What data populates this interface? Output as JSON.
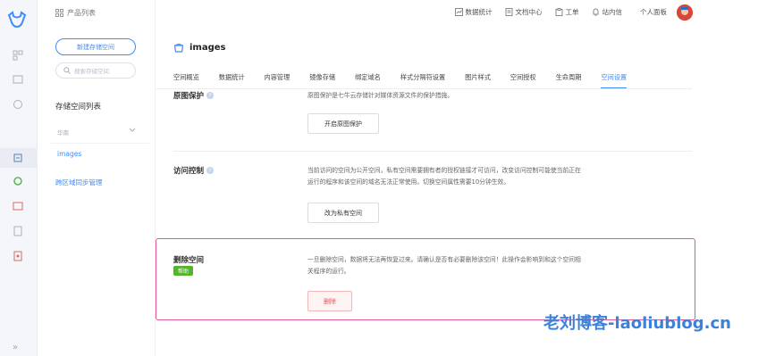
{
  "sidebar_rail": {
    "logo": "qiniu-cow-logo",
    "icons": [
      "overview-icon",
      "cdn-icon",
      "storage-icon",
      "kodo-icon",
      "media-icon",
      "monitor-icon",
      "log-icon",
      "billing-icon"
    ],
    "collapse_label": "»"
  },
  "side": {
    "product_list": "产品列表",
    "new_bucket_button": "新建存储空间",
    "search_placeholder": "搜索存储空间",
    "list_title": "存储空间列表",
    "group_label": "华南",
    "bucket_name": "images",
    "cross_region_sync": "跨区域同步管理"
  },
  "header": {
    "links": [
      {
        "label": "数据统计",
        "icon": "chart-icon"
      },
      {
        "label": "文档中心",
        "icon": "doc-icon"
      },
      {
        "label": "工单",
        "icon": "ticket-icon"
      },
      {
        "label": "站内信",
        "icon": "bell-icon"
      }
    ],
    "personal_panel": "个人面板"
  },
  "main": {
    "bucket_title": "images",
    "tabs": [
      "空间概览",
      "数据统计",
      "内容管理",
      "镜像存储",
      "绑定域名",
      "样式分隔符设置",
      "图片样式",
      "空间授权",
      "生命周期",
      "空间设置"
    ],
    "active_tab": "空间设置",
    "origin_protect": {
      "title": "原图保护",
      "desc": "原图保护是七牛云存储针对媒体资源文件的保护措施。",
      "button": "开启原图保护"
    },
    "access_control": {
      "title": "访问控制",
      "desc_line1": "当前访问的空间为公开空间，私有空间需要拥有者的授权链接才可访问，改变访问控制可能使当前正在",
      "desc_line2": "运行的程序和该空间的域名无法正常使用。切换空间属性需要10分钟生效。",
      "button": "改为私有空间"
    },
    "delete_space": {
      "title": "删除空间",
      "badge": "帮助",
      "desc_line1": "一旦删除空间，数据将无法再恢复过来。请确认是否有必要删除该空间！此操作会影响到和这个空间相",
      "desc_line2": "关程序的运行。",
      "button": "删除"
    }
  },
  "watermark": "老刘博客-laoliublog.cn",
  "colors": {
    "accent": "#3d8bfd",
    "danger": "#e05252",
    "highlight": "#e45893",
    "success": "#52b52c"
  }
}
